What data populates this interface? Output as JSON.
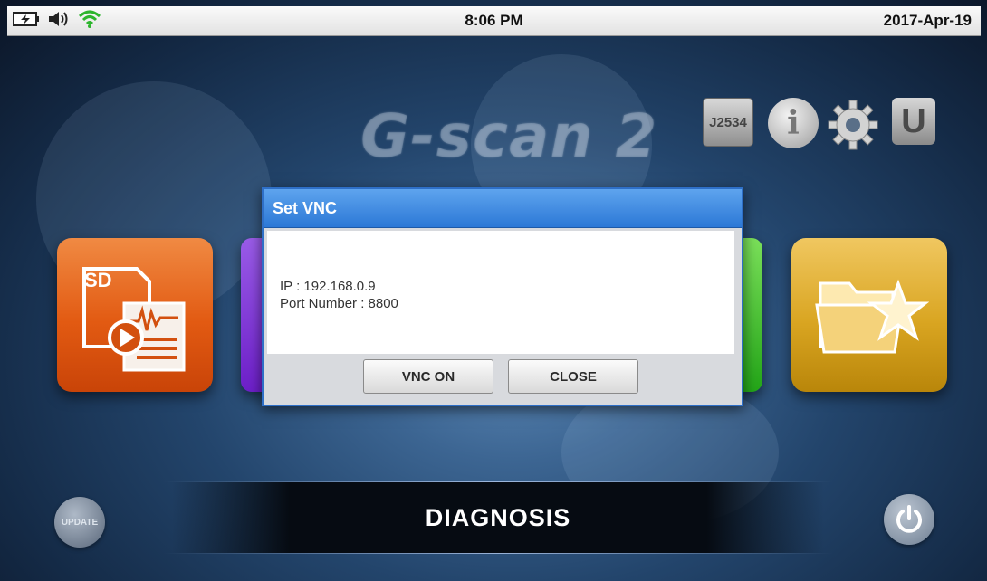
{
  "status_bar": {
    "time": "8:06 PM",
    "date": "2017-Apr-19",
    "icons": [
      "battery-charging-icon",
      "speaker-icon",
      "wifi-icon"
    ]
  },
  "header": {
    "logo_text": "G-scan 2",
    "icons": [
      {
        "name": "j2534-icon",
        "label": "J2534"
      },
      {
        "name": "info-icon",
        "label": "i"
      },
      {
        "name": "gear-icon"
      },
      {
        "name": "u-icon",
        "label": "U"
      }
    ]
  },
  "tiles": {
    "sd_label": "SD"
  },
  "dialog": {
    "title": "Set VNC",
    "ip_line": "IP : 192.168.0.9",
    "port_line": "Port Number : 8800",
    "vnc_on_label": "VNC ON",
    "close_label": "CLOSE"
  },
  "footer": {
    "title": "DIAGNOSIS",
    "update_label": "UPDATE"
  },
  "colors": {
    "dialog_title": "#2c78d6",
    "tile_orange": "#e25a12",
    "tile_gold": "#d9a521",
    "tile_purple": "#7a2ed6",
    "tile_green": "#2fb11f"
  }
}
